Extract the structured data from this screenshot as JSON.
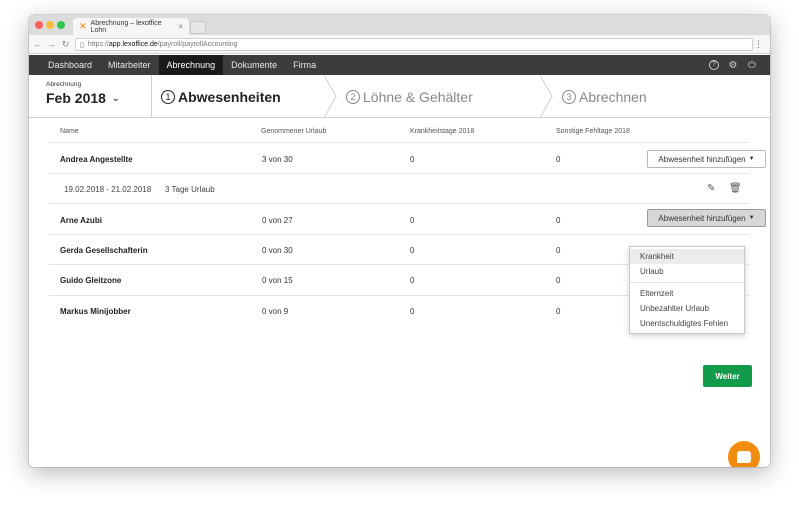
{
  "browser": {
    "tab_title": "Abrechnung – lexoffice Lohn",
    "tab_close": "×",
    "url_prefix": "https://",
    "url_host": "app.lexoffice.de",
    "url_path": "/payroll/payrollAccounting",
    "menu": "⋮"
  },
  "nav": {
    "items": [
      "Dashboard",
      "Mitarbeiter",
      "Abrechnung",
      "Dokumente",
      "Firma"
    ],
    "active_index": 2,
    "icons": [
      "help-icon",
      "settings-icon",
      "power-icon"
    ]
  },
  "period": {
    "label": "Abrechnung",
    "value": "Feb 2018"
  },
  "steps": [
    {
      "num": "1",
      "label": "Abwesenheiten",
      "active": true
    },
    {
      "num": "2",
      "label": "Löhne & Gehälter",
      "active": false
    },
    {
      "num": "3",
      "label": "Abrechnen",
      "active": false
    }
  ],
  "table": {
    "headers": [
      "Name",
      "Genommener Urlaub",
      "Krankheitstage 2018",
      "Sonstige Fehltage 2018"
    ],
    "button_label": "Abwesenheit hinzufügen",
    "rows": [
      {
        "name": "Andrea Angestellte",
        "urlaub": "3 von 30",
        "krank": "0",
        "sonstige": "0"
      },
      {
        "name": "Arne Azubi",
        "urlaub": "0 von 27",
        "krank": "0",
        "sonstige": "0"
      },
      {
        "name": "Gerda Gesellschafterin",
        "urlaub": "0 von 30",
        "krank": "0",
        "sonstige": "0"
      },
      {
        "name": "Guido Gleitzone",
        "urlaub": "0 von 15",
        "krank": "0",
        "sonstige": "0"
      },
      {
        "name": "Markus Minijobber",
        "urlaub": "0 von 9",
        "krank": "0",
        "sonstige": "0"
      }
    ],
    "detail": {
      "range": "19.02.2018 - 21.02.2018",
      "info": "3 Tage Urlaub"
    }
  },
  "dropdown": {
    "items_top": [
      "Krankheit",
      "Urlaub"
    ],
    "items_bottom": [
      "Elternzeit",
      "Unbezahlter Urlaub",
      "Unentschuldigtes Fehlen"
    ]
  },
  "next_button": "Weiter"
}
